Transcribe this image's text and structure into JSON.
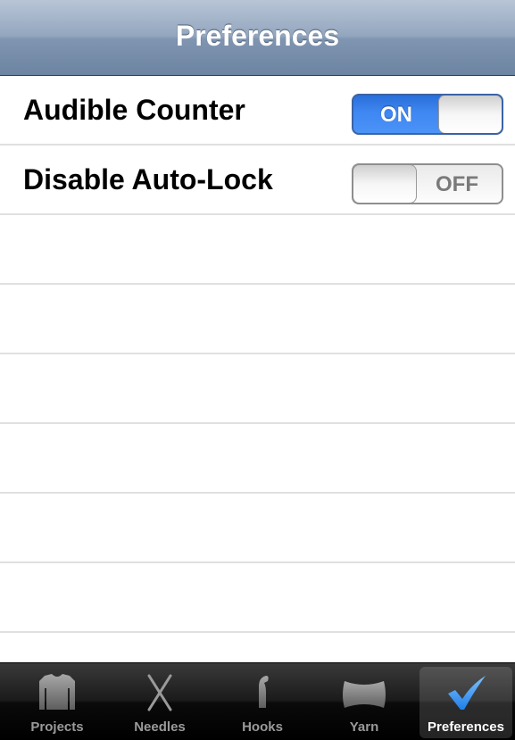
{
  "navbar": {
    "title": "Preferences"
  },
  "settings": [
    {
      "label": "Audible Counter",
      "state": "ON"
    },
    {
      "label": "Disable Auto-Lock",
      "state": "OFF"
    }
  ],
  "empty_rows": 6,
  "colors": {
    "switch_on": "#3f87f2",
    "selected_check": "#2f8ff0",
    "tab_icon": "#8a8a8a"
  },
  "tabbar": {
    "items": [
      {
        "label": "Projects",
        "icon": "sweater-icon"
      },
      {
        "label": "Needles",
        "icon": "needles-icon"
      },
      {
        "label": "Hooks",
        "icon": "hook-icon"
      },
      {
        "label": "Yarn",
        "icon": "yarn-icon"
      },
      {
        "label": "Preferences",
        "icon": "checkmark-icon",
        "selected": true
      }
    ]
  }
}
